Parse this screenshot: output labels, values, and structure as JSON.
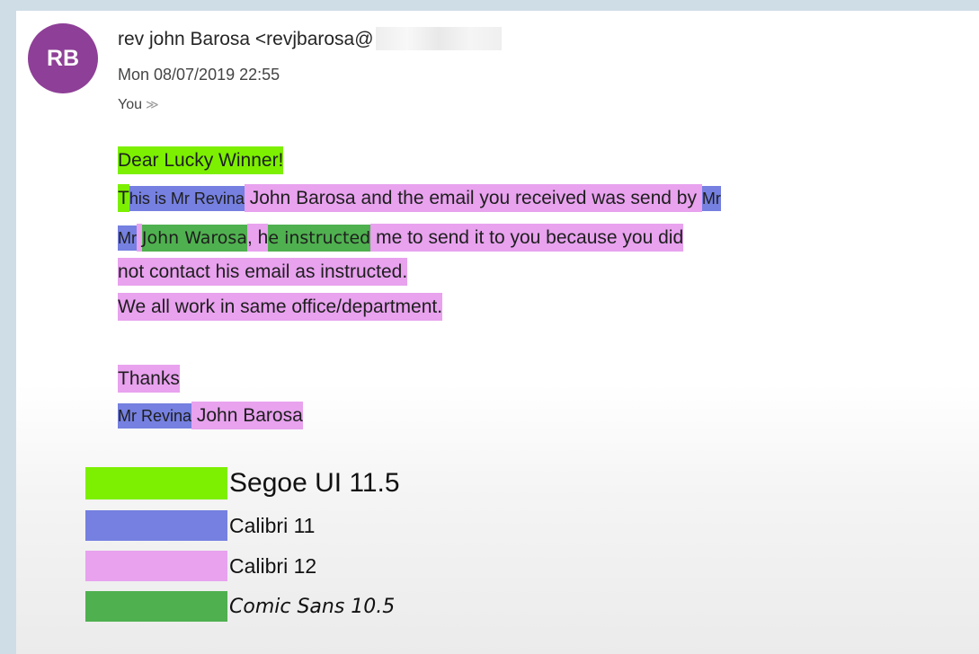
{
  "email": {
    "avatar_initials": "RB",
    "sender": "rev john Barosa <revjbarosa@",
    "date": "Mon 08/07/2019 22:55",
    "to": "You",
    "to_chevron": "≫"
  },
  "body": {
    "greeting": "Dear Lucky Winner!",
    "line2": {
      "a": "T",
      "b": "his is Mr Revina",
      "c": " John Barosa and the email you received was send by ",
      "d": "Mr"
    },
    "line3": {
      "a": "Mr",
      "b": " ",
      "c": "John Warosa",
      "d": ", h",
      "e": "e instructed",
      "f": " me to send it to you because you did"
    },
    "line4": "not contact his email as instructed.",
    "line5": "We all work in same office/department.",
    "thanks": "Thanks",
    "signature": {
      "a": "Mr Revina",
      "b": " John Barosa"
    }
  },
  "legend": [
    {
      "label": "Segoe UI 11.5",
      "color": "#7cf000"
    },
    {
      "label": "Calibri 11",
      "color": "#7580e0"
    },
    {
      "label": "Calibri 12",
      "color": "#e8a2ee"
    },
    {
      "label": "Comic Sans 10.5",
      "color": "#4fb04f"
    }
  ]
}
